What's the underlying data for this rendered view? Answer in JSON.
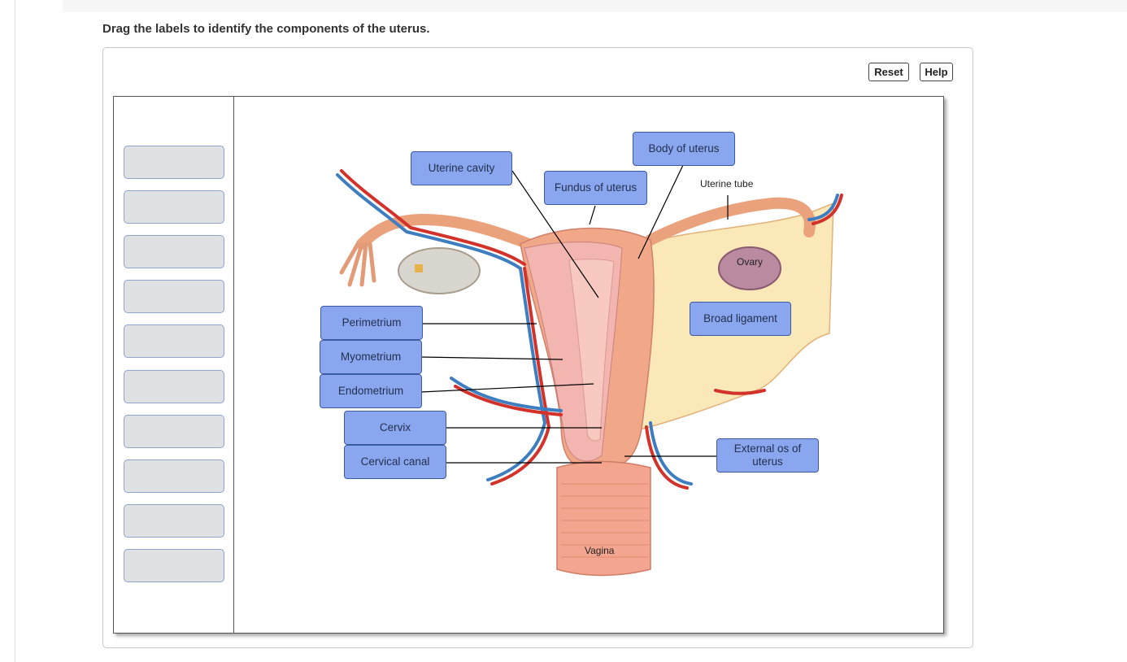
{
  "prompt": "Drag the labels to identify the components of the uterus.",
  "buttons": {
    "reset": "Reset",
    "help": "Help"
  },
  "drop_slots_count": 10,
  "labels": {
    "uterine_cavity": "Uterine cavity",
    "body_of_uterus": "Body of uterus",
    "fundus_of_uterus": "Fundus of uterus",
    "perimetrium": "Perimetrium",
    "myometrium": "Myometrium",
    "endometrium": "Endometrium",
    "cervix": "Cervix",
    "cervical_canal": "Cervical canal",
    "broad_ligament": "Broad ligament",
    "external_os": "External os of uterus"
  },
  "diagram_text": {
    "uterine_tube": "Uterine tube",
    "ovary": "Ovary",
    "vagina": "Vagina"
  },
  "colors": {
    "label_fill": "#8aa6ef",
    "label_border": "#3b5aa6",
    "slot_fill": "#e0e1e2"
  }
}
